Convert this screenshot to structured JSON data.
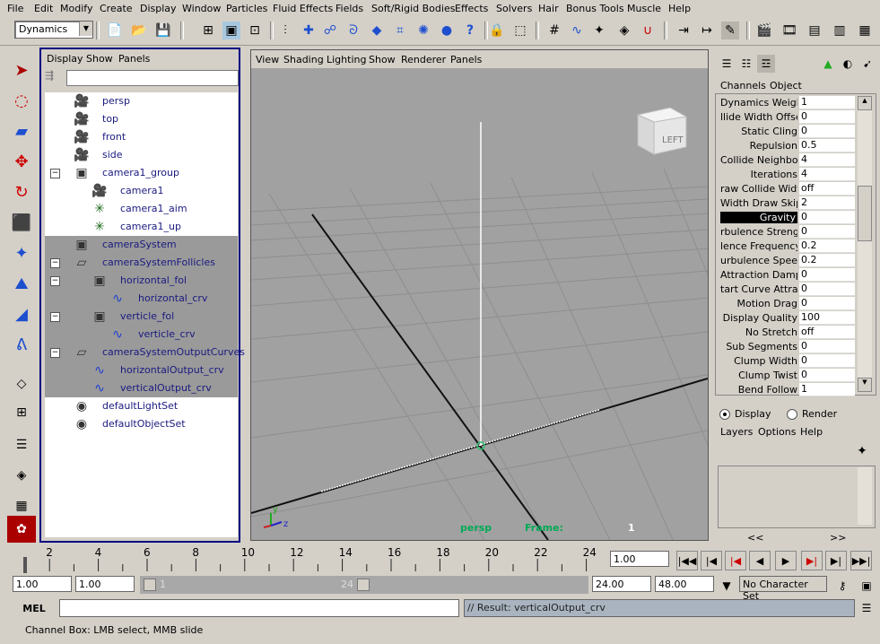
{
  "menubar": [
    "File",
    "Edit",
    "Modify",
    "Create",
    "Display",
    "Window",
    "Particles",
    "Fluid Effects",
    "Fields",
    "Soft/Rigid Bodies",
    "Effects",
    "Solvers",
    "Hair",
    "Bonus Tools",
    "Muscle",
    "Help"
  ],
  "mode_selector": "Dynamics",
  "outliner": {
    "menu": [
      "Display",
      "Show",
      "Panels"
    ],
    "items": [
      {
        "label": "persp",
        "selected": false
      },
      {
        "label": "top",
        "selected": false
      },
      {
        "label": "front",
        "selected": false
      },
      {
        "label": "side",
        "selected": false
      },
      {
        "label": "camera1_group",
        "selected": false
      },
      {
        "label": "camera1",
        "selected": false
      },
      {
        "label": "camera1_aim",
        "selected": false
      },
      {
        "label": "camera1_up",
        "selected": false
      },
      {
        "label": "cameraSystem",
        "selected": true
      },
      {
        "label": "cameraSystemFollicles",
        "selected": true
      },
      {
        "label": "horizontal_fol",
        "selected": true
      },
      {
        "label": "horizontal_crv",
        "selected": true
      },
      {
        "label": "verticle_fol",
        "selected": true
      },
      {
        "label": "verticle_crv",
        "selected": true
      },
      {
        "label": "cameraSystemOutputCurves",
        "selected": true
      },
      {
        "label": "horizontalOutput_crv",
        "selected": true
      },
      {
        "label": "verticalOutput_crv",
        "selected": true
      },
      {
        "label": "defaultLightSet",
        "selected": false
      },
      {
        "label": "defaultObjectSet",
        "selected": false
      }
    ]
  },
  "viewport": {
    "menu": [
      "View",
      "Shading",
      "Lighting",
      "Show",
      "Renderer",
      "Panels"
    ],
    "camera_label": "persp",
    "frame_label": "Frame:",
    "frame_value": "1",
    "view_cube_label": "LEFT"
  },
  "channel_box": {
    "menu": [
      "Channels",
      "Object"
    ],
    "attributes": [
      {
        "name": "Dynamics Weight",
        "value": "1"
      },
      {
        "name": "llide Width Offset",
        "value": "0"
      },
      {
        "name": "Static Cling",
        "value": "0"
      },
      {
        "name": "Repulsion",
        "value": "0.5"
      },
      {
        "name": "Collide Neighbors",
        "value": "4"
      },
      {
        "name": "Iterations",
        "value": "4"
      },
      {
        "name": "raw Collide Width",
        "value": "off"
      },
      {
        "name": "Width Draw Skip",
        "value": "2"
      },
      {
        "name": "Gravity",
        "value": "0"
      },
      {
        "name": "rbulence Strength",
        "value": "0"
      },
      {
        "name": "lence Frequency",
        "value": "0.2"
      },
      {
        "name": "urbulence Speed",
        "value": "0.2"
      },
      {
        "name": "Attraction Damp",
        "value": "0"
      },
      {
        "name": "tart Curve Attract",
        "value": "0"
      },
      {
        "name": "Motion Drag",
        "value": "0"
      },
      {
        "name": "Display Quality",
        "value": "100"
      },
      {
        "name": "No Stretch",
        "value": "off"
      },
      {
        "name": "Sub Segments",
        "value": "0"
      },
      {
        "name": "Clump Width",
        "value": "0"
      },
      {
        "name": "Clump Twist",
        "value": "0"
      },
      {
        "name": "Bend Follow",
        "value": "1"
      }
    ]
  },
  "layer_editor": {
    "display_label": "Display",
    "render_label": "Render",
    "menu": [
      "Layers",
      "Options",
      "Help"
    ],
    "nav_left": "<<",
    "nav_right": ">>"
  },
  "timeline": {
    "ticks": [
      "2",
      "4",
      "6",
      "8",
      "10",
      "12",
      "14",
      "16",
      "18",
      "20",
      "22",
      "24"
    ],
    "current_frame": "1.00"
  },
  "range": {
    "start": "1.00",
    "playback_start": "1.00",
    "slider_start": "1",
    "slider_end": "24",
    "playback_end": "24.00",
    "end": "48.00",
    "character_set": "No Character Set"
  },
  "command_line": {
    "mode": "MEL",
    "result": "// Result: verticalOutput_crv"
  },
  "help_line": "Channel Box: LMB select, MMB slide"
}
